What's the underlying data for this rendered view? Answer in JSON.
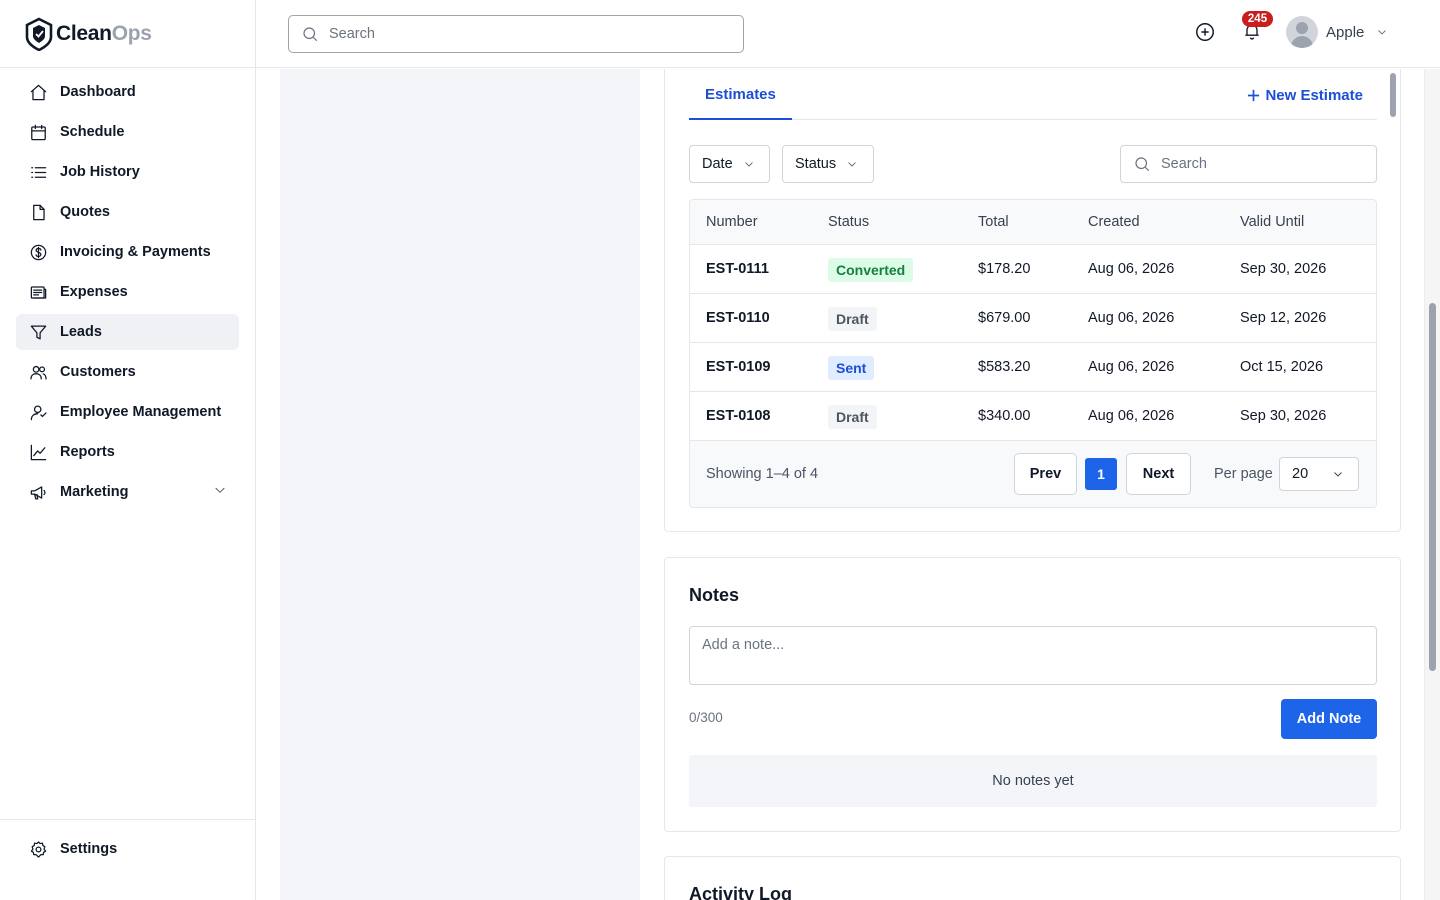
{
  "brand": {
    "name_part1": "Clean",
    "name_part2": "Ops"
  },
  "sidebar": {
    "items": [
      {
        "label": "Dashboard",
        "icon": "home-icon"
      },
      {
        "label": "Schedule",
        "icon": "calendar-icon"
      },
      {
        "label": "Job History",
        "icon": "list-icon"
      },
      {
        "label": "Quotes",
        "icon": "document-icon"
      },
      {
        "label": "Invoicing & Payments",
        "icon": "dollar-circle-icon"
      },
      {
        "label": "Expenses",
        "icon": "receipt-icon"
      },
      {
        "label": "Leads",
        "icon": "filter-icon",
        "active": true
      },
      {
        "label": "Customers",
        "icon": "users-icon"
      },
      {
        "label": "Employee Management",
        "icon": "user-manage-icon"
      },
      {
        "label": "Reports",
        "icon": "chart-line-icon"
      },
      {
        "label": "Marketing",
        "icon": "megaphone-icon",
        "expandable": true
      }
    ],
    "settings_label": "Settings"
  },
  "header": {
    "search_placeholder": "Search",
    "notification_count": "245",
    "user_name": "Apple"
  },
  "estimates": {
    "tab_label": "Estimates",
    "new_button_label": "New Estimate",
    "filters": {
      "date_label": "Date",
      "status_label": "Status"
    },
    "search_placeholder": "Search",
    "columns": [
      "Number",
      "Status",
      "Total",
      "Created",
      "Valid Until"
    ],
    "rows": [
      {
        "number": "EST-0111",
        "status": "Converted",
        "total": "$178.20",
        "created": "Aug 06, 2026",
        "valid_until": "Sep 30, 2026"
      },
      {
        "number": "EST-0110",
        "status": "Draft",
        "total": "$679.00",
        "created": "Aug 06, 2026",
        "valid_until": "Sep 12, 2026"
      },
      {
        "number": "EST-0109",
        "status": "Sent",
        "total": "$583.20",
        "created": "Aug 06, 2026",
        "valid_until": "Oct 15, 2026"
      },
      {
        "number": "EST-0108",
        "status": "Draft",
        "total": "$340.00",
        "created": "Aug 06, 2026",
        "valid_until": "Sep 30, 2026"
      }
    ],
    "status_colors": {
      "Converted": "#15803d",
      "Draft": "#4b5563",
      "Sent": "#1d4ed8"
    },
    "pagination": {
      "showing": "Showing 1–4 of 4",
      "prev_label": "Prev",
      "current_page": "1",
      "next_label": "Next",
      "per_page_label": "Per page",
      "per_page_value": "20"
    }
  },
  "notes": {
    "title": "Notes",
    "placeholder": "Add a note...",
    "char_count": "0/300",
    "add_button_label": "Add Note",
    "empty_text": "No notes yet"
  },
  "activity": {
    "title": "Activity Log"
  },
  "colors": {
    "accent": "#1d64e8",
    "badge": "#c81e1e"
  }
}
